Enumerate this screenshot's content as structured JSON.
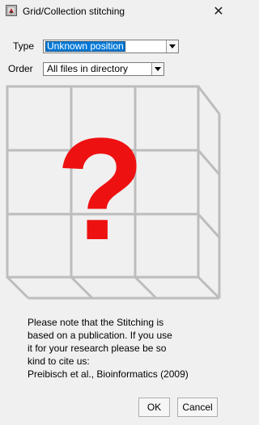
{
  "window": {
    "title": "Grid/Collection stitching",
    "close_glyph": "✕"
  },
  "type_row": {
    "label": "Type",
    "value": "Unknown position"
  },
  "order_row": {
    "label": "Order",
    "value": "All files in directory"
  },
  "illustration": {
    "question_mark": "?",
    "question_color": "#ee1111",
    "grid_color": "#bdbdbd"
  },
  "note": {
    "text": "Please note that the Stitching is\nbased on a publication. If you use\nit for your research please be so\nkind to cite us:\nPreibisch et al., Bioinformatics (2009)"
  },
  "buttons": {
    "ok": "OK",
    "cancel": "Cancel"
  },
  "icons": {
    "app": "fiji-app-icon",
    "close": "close-icon",
    "dropdown": "chevron-down-icon"
  }
}
